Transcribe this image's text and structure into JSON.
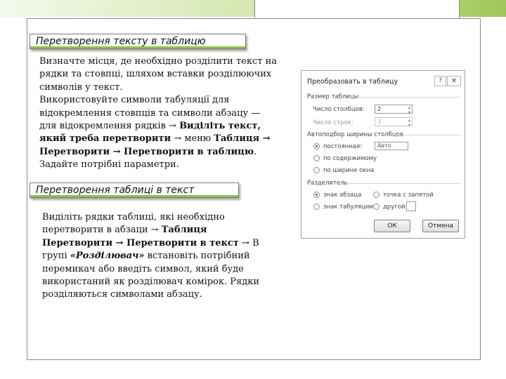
{
  "section1": {
    "title": "Перетворення тексту в таблицю",
    "paragraph_lines": [
      "Визначте місця, де необхідно розділити текст на",
      "рядки та стовпці, шляхом вставки розділюючих",
      "символів у текст.",
      "Використовуйте символи табуляції для",
      "відокремлення стовпців та символи абзацу —",
      "для відокремлення рядків → "
    ],
    "bold_1": "Виділіть текст,",
    "bold_2": "який треба перетворити",
    "text_menu": " → меню ",
    "bold_table": "Таблиця →",
    "bold_3": "Перетворити → Перетворити в таблицю",
    "text_dot": ".",
    "last_line": "Задайте потрібні параметри."
  },
  "section2": {
    "title": "Перетворення таблиці в текст",
    "line1": "Виділіть рядки таблиці, які необхідно",
    "line2": "перетворити в абзаци → ",
    "bold_table": "Таблиця",
    "bold_convert": "Перетворити  → Перетворити в текст",
    "text_arrow_in": " → В",
    "line4": "групі ",
    "bold_italic_sep": "«Розділювач»",
    "line4_rest": " встановіть потрібний",
    "line5": "перемикач або введіть символ, який буде",
    "line6": "використаний як розділювач комірок. Рядки",
    "line7": "розділяються символами абзацу."
  },
  "dialog": {
    "title": "Преобразовать в таблицу",
    "help": "?",
    "close": "✕",
    "group_size": "Размер таблицы",
    "cols_label": "Число столбцов:",
    "cols_value": "2",
    "rows_label": "Число строк:",
    "rows_value": "3",
    "group_autofit": "Автоподбор ширины столбцов",
    "opt_fixed": "постоянная:",
    "fixed_value": "Авто",
    "opt_content": "по содержимому",
    "opt_window": "по ширине окна",
    "group_sep": "Разделитель",
    "sep_para": "знак абзаца",
    "sep_semicolon": "точка с запятой",
    "sep_tab": "знак табуляции",
    "sep_other": "другой:",
    "ok": "ОК",
    "cancel": "Отмена"
  }
}
